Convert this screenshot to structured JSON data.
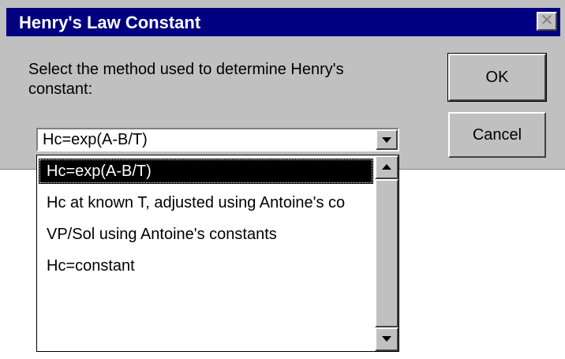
{
  "window": {
    "title": "Henry's Law Constant",
    "close_glyph": "✕",
    "background_color": "#c0c0c0",
    "titlebar_color": "#000080"
  },
  "prompt": {
    "text": "Select the method used to determine Henry's constant:"
  },
  "buttons": {
    "ok_label": "OK",
    "cancel_label": "Cancel"
  },
  "method_select": {
    "selected_value": "Hc=exp(A-B/T)",
    "options": [
      "Hc=exp(A-B/T)",
      "Hc at known T, adjusted using Antoine's co",
      "VP/Sol using Antoine's constants",
      "Hc=constant"
    ],
    "highlighted_index": 0
  }
}
